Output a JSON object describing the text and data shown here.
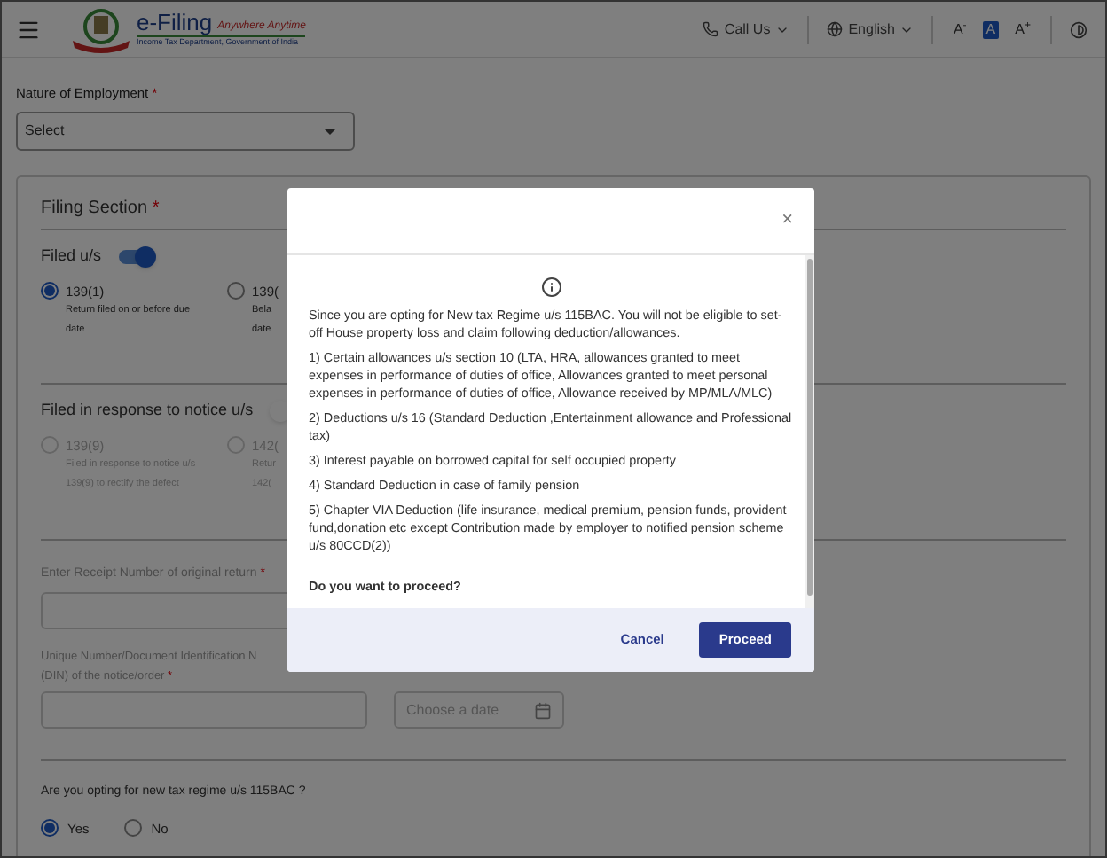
{
  "header": {
    "logo_title": "e-Filing",
    "logo_tagline": "Anywhere Anytime",
    "logo_subtitle": "Income Tax Department, Government of India",
    "call_us": "Call Us",
    "language": "English",
    "font_sizes": [
      {
        "label": "A$^{-}$",
        "selected": false
      },
      {
        "label": "A",
        "selected": true
      },
      {
        "label": "A$^{+}$",
        "selected": false
      }
    ]
  },
  "employment": {
    "label": "Nature of Employment",
    "required_mark": "*",
    "placeholder": "Select"
  },
  "filing_section": {
    "title": "Filing Section",
    "required_mark": "*",
    "groups": [
      {
        "title": "Filed u/s",
        "on": true,
        "options": [
          {
            "label": "139(1)",
            "description": [
              "Return filed on or before due",
              "date"
            ],
            "selected": true,
            "disabled": false
          },
          {
            "label": "139(",
            "description": [
              "Bela",
              "date"
            ],
            "selected": false,
            "disabled": false
          }
        ]
      },
      {
        "title": "Filed in response to notice u/s",
        "on": false,
        "options": [
          {
            "label": "139(9)",
            "description": [
              "Filed in response to notice u/s",
              "139(9) to rectify the defect"
            ],
            "selected": false,
            "disabled": true
          },
          {
            "label": "142(",
            "description": [
              "Retur",
              "142("
            ],
            "selected": false,
            "disabled": true
          }
        ]
      }
    ],
    "receipt": {
      "label": "Enter Receipt Number of original return",
      "required_mark": "*"
    },
    "din": {
      "label": [
        "Unique Number/Document Identification N",
        "(DIN) of the notice/order"
      ],
      "required_mark": "*"
    },
    "date": {
      "placeholder": "Choose a date"
    },
    "regime": {
      "label": "Are you opting for new tax regime u/s 115BAC ?",
      "options": [
        {
          "label": "Yes",
          "selected": true
        },
        {
          "label": "No",
          "selected": false
        }
      ]
    }
  },
  "dialog": {
    "intro": "Since you are opting for New tax Regime u/s 115BAC. You will not be eligible to set-off House property loss and claim following deduction/allowances.",
    "items": [
      "1) Certain allowances u/s section 10 (LTA, HRA, allowances granted to meet expenses in performance of duties of office, Allowances granted to meet personal expenses in performance of duties of office, Allowance received by MP/MLA/MLC)",
      "2) Deductions u/s 16 (Standard Deduction ,Entertainment allowance and Professional tax)",
      "3) Interest payable on borrowed capital for self occupied property",
      "4) Standard Deduction in case of family pension",
      "5) Chapter VIA Deduction (life insurance, medical premium, pension funds, provident fund,donation etc except Contribution made by employer to notified pension scheme u/s 80CCD(2))"
    ],
    "question": "Do you want to proceed?",
    "close": "×",
    "cancel": "Cancel",
    "proceed": "Proceed"
  }
}
